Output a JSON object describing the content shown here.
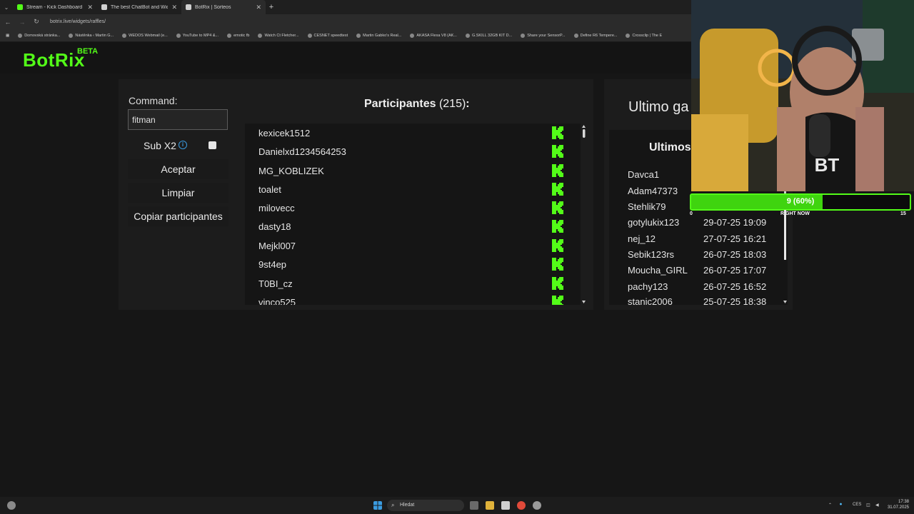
{
  "browser": {
    "tabs": [
      {
        "title": "Stream - Kick Dashboard",
        "favicon_color": "#53fc18",
        "active": false
      },
      {
        "title": "The best ChatBot and Widgets",
        "favicon_color": "#d0d0d0",
        "active": false
      },
      {
        "title": "BotRix | Sorteos",
        "favicon_color": "#d0d0d0",
        "active": true
      }
    ],
    "url": "botrix.live/widgets/raffles/",
    "bookmarks": [
      "Domovská stránka...",
      "Nástěnka ‹ Martin G...",
      "WEDOS Webmail (e...",
      "YouTube to MP4 &...",
      "emotic fb",
      "Watch Ct Fletcher...",
      "CESNET speedtest",
      "Martin Gabko's Real...",
      "AKASA Flexa V8 (AK...",
      "G.SKILL 32GB KIT D...",
      "Share your SensorP...",
      "Define R6 Tempere...",
      "Crossclip | The E"
    ]
  },
  "app": {
    "logo": "BotRix",
    "badge": "BETA",
    "accent": "#53fc18"
  },
  "controls": {
    "command_label": "Command:",
    "command_value": "fitman",
    "sub_label": "Sub X2",
    "sub_checked": false,
    "accept_label": "Aceptar",
    "clear_label": "Limpiar",
    "copy_label": "Copiar participantes"
  },
  "participants": {
    "title": "Participantes",
    "count": "(215)",
    "colon": ":",
    "list": [
      "kexicek1512",
      "Danielxd1234564253",
      "MG_KOBLIZEK",
      "toalet",
      "milovecc",
      "dasty18",
      "Mejkl007",
      "9st4ep",
      "T0BI_cz",
      "vinco525"
    ]
  },
  "winners": {
    "title": "Ultimo ga",
    "subtitle": "Ultimos",
    "list": [
      {
        "name": "Davca1",
        "date": ""
      },
      {
        "name": "Adam47373",
        "date": ""
      },
      {
        "name": "Stehlik79",
        "date": ""
      },
      {
        "name": "gotylukix123",
        "date": "29-07-25 19:09"
      },
      {
        "name": "nej_12",
        "date": "27-07-25 16:21"
      },
      {
        "name": "Sebik123rs",
        "date": "26-07-25 18:03"
      },
      {
        "name": "Moucha_GIRL",
        "date": "26-07-25 17:07"
      },
      {
        "name": "pachy123",
        "date": "26-07-25 16:52"
      },
      {
        "name": "stanic2006",
        "date": "25-07-25 18:38"
      }
    ]
  },
  "goal": {
    "text": "9 (60%)",
    "progress": 0.6,
    "min": "0",
    "max": "15",
    "marker": "RIGHT NOW"
  },
  "taskbar": {
    "search": "Hledat",
    "lang": "CES",
    "time": "17:38",
    "date": "31.07.2025"
  }
}
